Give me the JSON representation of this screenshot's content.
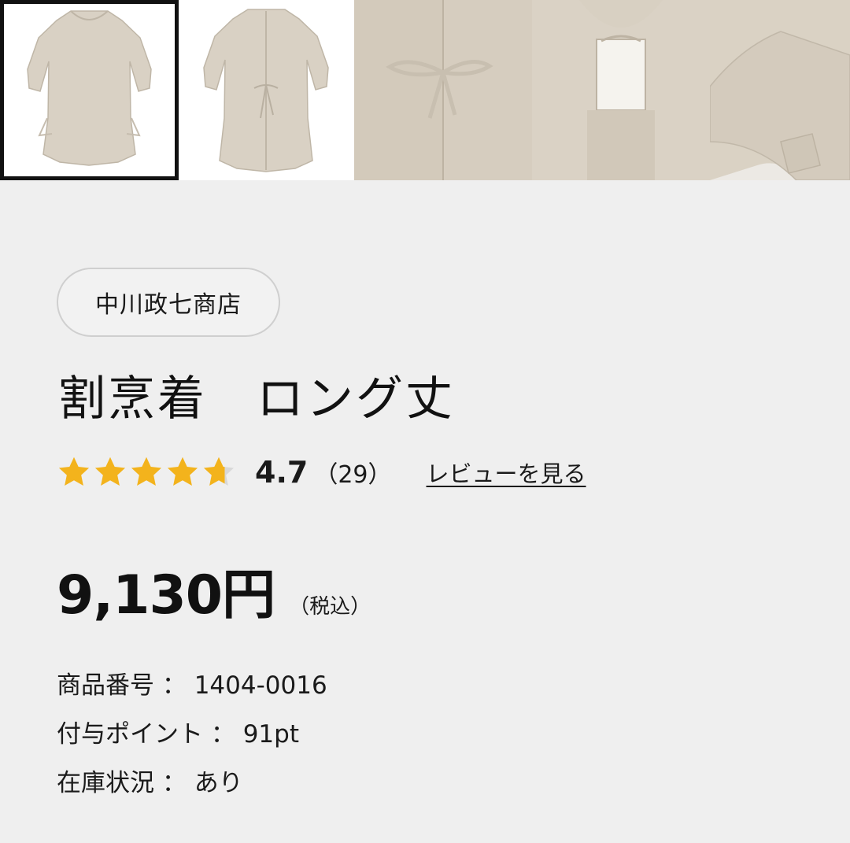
{
  "gallery": {
    "images": [
      {
        "name": "front-view-image",
        "selected": true
      },
      {
        "name": "back-view-image",
        "selected": false
      },
      {
        "name": "back-ties-closeup-image",
        "selected": false
      },
      {
        "name": "neck-opening-closeup-image",
        "selected": false
      },
      {
        "name": "sleeve-cuff-closeup-image",
        "selected": false
      }
    ]
  },
  "shop": {
    "name": "中川政七商店"
  },
  "product": {
    "title": "割烹着　ロング丈"
  },
  "rating": {
    "value": "4.7",
    "count": "（29）",
    "stars": 4.7,
    "review_link": "レビューを見る",
    "star_color": "#f3b31c",
    "empty_color": "#d8d8d8"
  },
  "price": {
    "amount": "9,130円",
    "tax_note": "（税込）"
  },
  "specs": [
    {
      "label": "商品番号 ： 1404-0016"
    },
    {
      "label": "付与ポイント ： 91pt"
    },
    {
      "label": "在庫状況 ： あり"
    }
  ]
}
